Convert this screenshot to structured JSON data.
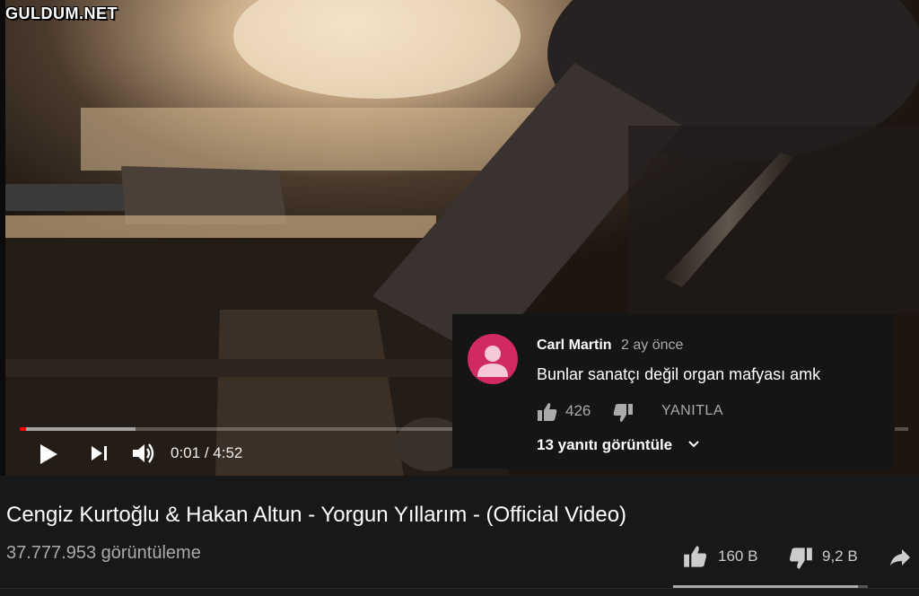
{
  "watermark": "GULDUM.NET",
  "player": {
    "current_time": "0:01",
    "separator": " / ",
    "duration": "4:52",
    "progress_fraction": 0.007,
    "buffered_fraction": 0.13,
    "icons": [
      "play-icon",
      "next-icon",
      "volume-icon"
    ]
  },
  "comment": {
    "author": "Carl Martin",
    "time": "2 ay önce",
    "text": "Bunlar sanatçı değil organ mafyası amk",
    "likes": "426",
    "reply_label": "YANITLA",
    "view_replies": "13 yanıtı görüntüle",
    "avatar_color": "#d12a63"
  },
  "video": {
    "title": "Cengiz Kurtoğlu & Hakan Altun - Yorgun Yıllarım - (Official Video)",
    "views": "37.777.953 görüntüleme",
    "likes": "160 B",
    "dislikes": "9,2 B",
    "like_ratio": 0.95
  }
}
